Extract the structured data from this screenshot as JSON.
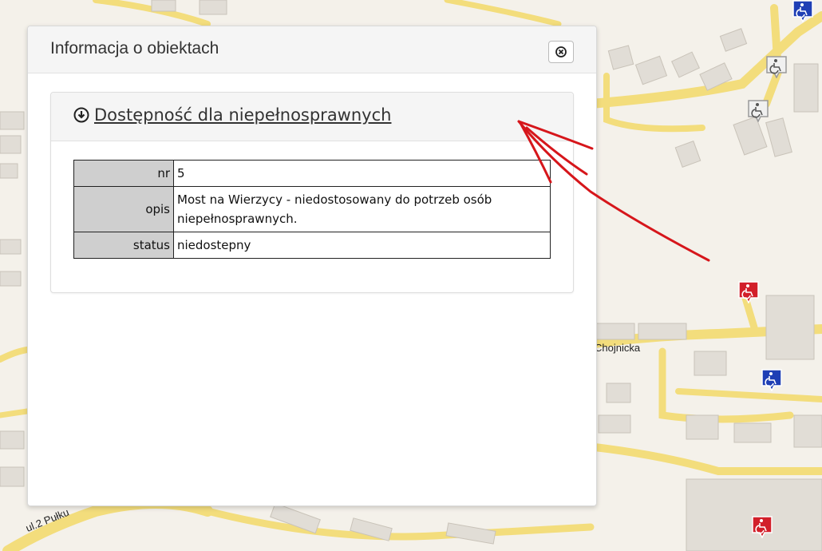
{
  "panel": {
    "title": "Informacja o obiektach",
    "close_icon": "close-circle-icon"
  },
  "section": {
    "toggle_icon": "collapse-down-icon",
    "title": "Dostępność dla niepełnosprawnych"
  },
  "table": {
    "rows": [
      {
        "key": "nr",
        "value": "5"
      },
      {
        "key": "opis",
        "value": "Most na Wierzycy - niedostosowany do potrzeb osób niepełnosprawnych."
      },
      {
        "key": "status",
        "value": "niedostepny"
      }
    ]
  },
  "map": {
    "street_label_1": "Chojnicka",
    "street_label_2": "ul.2 Pułku",
    "marker_icon": "wheelchair-icon",
    "colors": {
      "road": "#f6e58a",
      "building": "#e4e1dc",
      "marker_blue": "#1f3fb5",
      "marker_red": "#d21f2a",
      "annotation": "#d6161b"
    }
  }
}
